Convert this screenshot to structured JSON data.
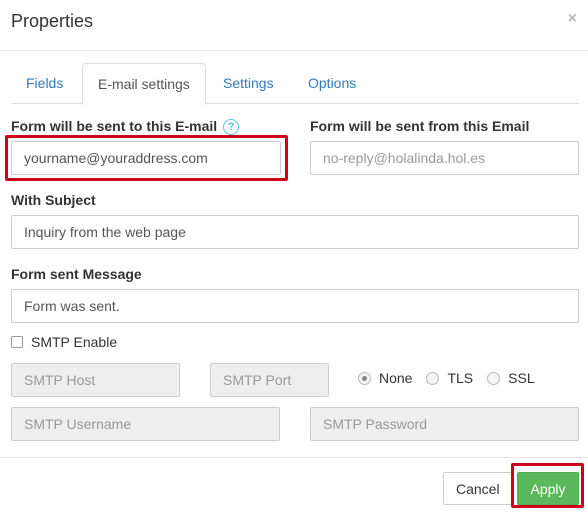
{
  "dialog": {
    "title": "Properties",
    "close_glyph": "×"
  },
  "tabs": [
    {
      "label": "Fields"
    },
    {
      "label": "E-mail settings"
    },
    {
      "label": "Settings"
    },
    {
      "label": "Options"
    }
  ],
  "form": {
    "to_label": "Form will be sent to this E-mail",
    "help_glyph": "?",
    "to_value": "yourname@youraddress.com",
    "from_label": "Form will be sent from this Email",
    "from_placeholder": "no-reply@holalinda.hol.es",
    "subject_label": "With Subject",
    "subject_value": "Inquiry from the web page",
    "message_label": "Form sent Message",
    "message_value": "Form was sent.",
    "smtp_enable_label": "SMTP Enable",
    "smtp_host_placeholder": "SMTP Host",
    "smtp_port_placeholder": "SMTP Port",
    "smtp_username_placeholder": "SMTP Username",
    "smtp_password_placeholder": "SMTP Password",
    "security_options": [
      {
        "label": "None",
        "checked": true
      },
      {
        "label": "TLS",
        "checked": false
      },
      {
        "label": "SSL",
        "checked": false
      }
    ]
  },
  "footer": {
    "cancel_label": "Cancel",
    "apply_label": "Apply"
  },
  "colors": {
    "accent_link": "#337ab7",
    "apply_green": "#5cb85c",
    "highlight_red": "#d0021b",
    "help_blue": "#5bc0de"
  }
}
